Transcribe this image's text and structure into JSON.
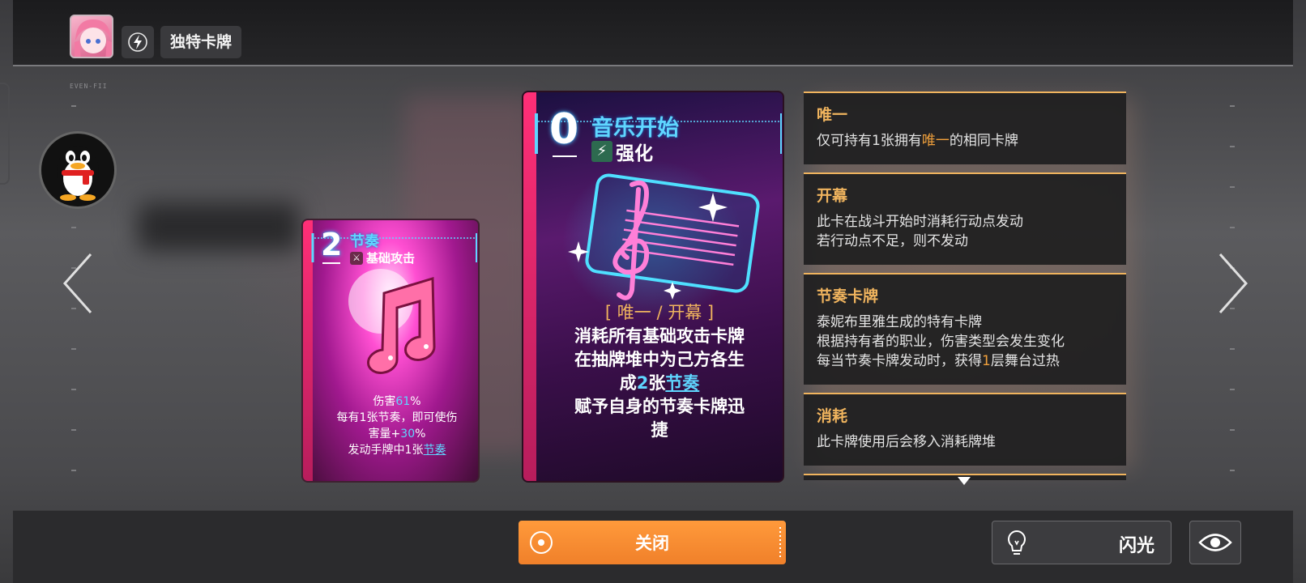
{
  "topbar": {
    "title": "独特卡牌",
    "avatar_icon": "character-portrait",
    "bolt_icon": "lightning-icon"
  },
  "hud_code": "EVEN-FII",
  "left_button_icon": "qq-penguin-icon",
  "cards": {
    "small": {
      "cost": "2",
      "name": "节奏",
      "type": "基础攻击",
      "type_icon": "crossed-swords-icon",
      "art_icon": "music-note-icon",
      "desc": {
        "l1_a": "伤害",
        "l1_b": "61",
        "l1_c": "%",
        "l2": "每有1张节奏，即可使伤",
        "l3_a": "害量+",
        "l3_b": "30",
        "l3_c": "%",
        "l4_a": "发动手牌中1张",
        "l4_b": "节奏"
      }
    },
    "large": {
      "cost": "0",
      "name": "音乐开始",
      "type": "强化",
      "type_icon": "lightning-icon",
      "art_icon": "treble-clef-icon",
      "keywords": "[ 唯一 / 开幕 ]",
      "desc": {
        "l1": "消耗所有基础攻击卡牌",
        "l2": "在抽牌堆中为己方各生",
        "l3_a": "成",
        "l3_b": "2",
        "l3_c": "张",
        "l3_d": "节奏",
        "l4": "赋予自身的节奏卡牌迅",
        "l5": "捷"
      }
    }
  },
  "info_panels": [
    {
      "title": "唯一",
      "lines": {
        "a": "仅可持有1张拥有",
        "b": "唯一",
        "c": "的相同卡牌"
      }
    },
    {
      "title": "开幕",
      "lines": {
        "l1": "此卡在战斗开始时消耗行动点发动",
        "l2": "若行动点不足，则不发动"
      }
    },
    {
      "title": "节奏卡牌",
      "lines": {
        "l1": "泰妮布里雅生成的特有卡牌",
        "l2": "根据持有者的职业，伤害类型会发生变化",
        "l3_a": "每当节奏卡牌发动时，获得",
        "l3_b": "1",
        "l3_c": "层舞台过热"
      }
    },
    {
      "title": "消耗",
      "lines": {
        "l1": "此卡牌使用后会移入消耗牌堆"
      }
    }
  ],
  "buttons": {
    "close": "关闭",
    "flash": "闪光",
    "flash_icon": "lightbulb-icon",
    "eye_icon": "eye-icon",
    "prev_icon": "chevron-left-icon",
    "next_icon": "chevron-right-icon"
  },
  "colors": {
    "accent_orange": "#f0802a",
    "keyword_gold": "#f0b45e",
    "card_cyan": "#5fd6ff",
    "card_stripe": "#ff2f77"
  }
}
